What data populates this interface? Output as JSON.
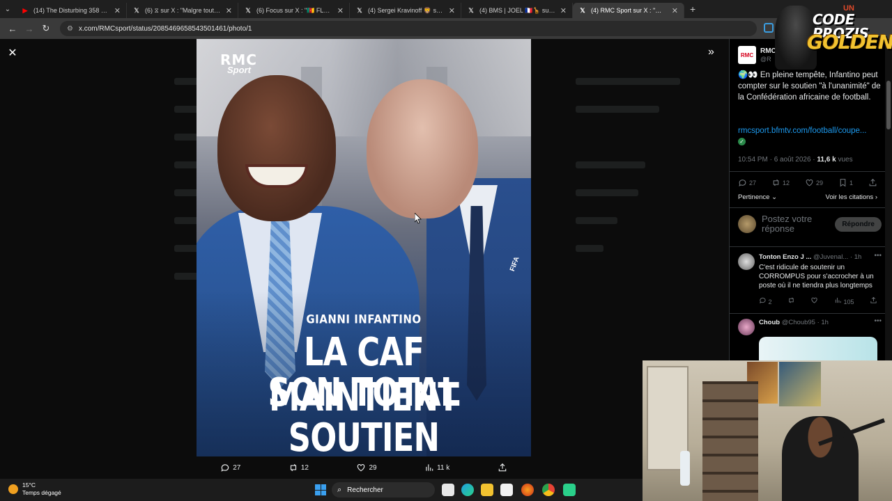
{
  "browser": {
    "tabs": [
      {
        "label": "(14) The Disturbing 358 Days D",
        "favicon": "youtube-icon",
        "active": false
      },
      {
        "label": "(6) ⧖ sur X : \"Malgre toutes les",
        "favicon": "x-icon",
        "active": false
      },
      {
        "label": "(6) Focus sur X : \"🇨🇲 FLASH",
        "favicon": "x-icon",
        "active": false
      },
      {
        "label": "(4) Sergei Kravinoff 🦁 sur X : \"",
        "favicon": "x-icon",
        "active": false
      },
      {
        "label": "(4) BMS | JOEL 🇫🇷🦒 sur X : \"m",
        "favicon": "x-icon",
        "active": false
      },
      {
        "label": "(4) RMC Sport sur X : \"🌍 👀 En",
        "favicon": "x-icon",
        "active": true
      }
    ],
    "url": "x.com/RMCsport/status/2085469658543501461/photo/1"
  },
  "photo": {
    "logo_line1": "RMC",
    "logo_line2": "Sport",
    "name_caption": "GIANNI INFANTINO",
    "headline_line1": "LA CAF MAINTIENT",
    "headline_line2": "SON TOTAL SOUTIEN",
    "jersey_badge": "FIFA"
  },
  "photo_actions": {
    "replies": "27",
    "reposts": "12",
    "likes": "29",
    "views": "11 k"
  },
  "tweet": {
    "author_name": "RMC",
    "author_handle": "@R",
    "text": "🌍👀 En pleine tempête, Infantino peut compter sur le soutien \"à l'unanimité\" de la Confédération africaine de football.",
    "link": "rmcsport.bfmtv.com/football/coupe...",
    "time": "10:54 PM · 6 août 2026 · ",
    "views_count": "11,6 k",
    "views_label": " vues",
    "stats": {
      "replies": "27",
      "reposts": "12",
      "likes": "29",
      "bookmarks": "1"
    },
    "sort_label": "Pertinence",
    "quotes_label": "Voir les citations",
    "reply_placeholder": "Postez votre réponse",
    "reply_button": "Répondre"
  },
  "replies": [
    {
      "name": "Tonton Enzo J ...",
      "handle": "@Juvenal...",
      "time": " · 1h",
      "text": "C'est ridicule de soutenir un CORROMPUS pour s'accrocher à un poste où il ne tiendra plus longtemps",
      "replies": "2",
      "views": "105"
    },
    {
      "name": "Choub",
      "handle": "@Choub95",
      "time": " · 1h"
    }
  ],
  "overlay": {
    "brand_line1": "CODE PROZIS",
    "brand_line2": "GOLDENG",
    "brand_tag": "UN"
  },
  "taskbar": {
    "temperature": "15°C",
    "weather": "Temps dégagé",
    "search_label": "Rechercher"
  }
}
